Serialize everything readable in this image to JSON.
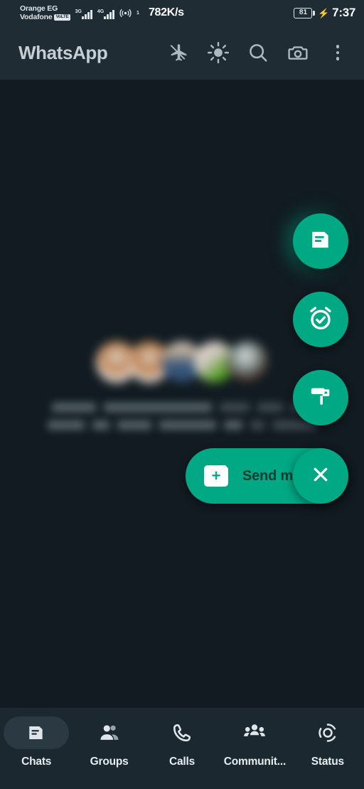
{
  "status_bar": {
    "carrier_primary": "Orange EG",
    "carrier_secondary": "Vodafone",
    "volte_badge": "VoLTE",
    "sim1_network": "3G",
    "sim2_network": "4G",
    "hotspot_superscript": "1",
    "network_speed": "782K/s",
    "battery_percent": "81",
    "charging_icon": "⚡",
    "time": "7:37"
  },
  "header": {
    "title": "WhatsApp",
    "actions": [
      {
        "name": "airplane-mode-icon",
        "label": "Airplane mode"
      },
      {
        "name": "brightness-icon",
        "label": "Brightness"
      },
      {
        "name": "search-icon",
        "label": "Search"
      },
      {
        "name": "camera-icon",
        "label": "Camera"
      },
      {
        "name": "overflow-menu-icon",
        "label": "More options"
      }
    ]
  },
  "main": {
    "invite_card": {
      "avatars_count": 5,
      "text_line1_redacted": true,
      "text_line2_redacted": true
    },
    "floating_actions": [
      {
        "name": "new-chat-fab",
        "icon": "message-icon",
        "highlighted": true
      },
      {
        "name": "reminder-fab",
        "icon": "alarm-check-icon",
        "highlighted": false
      },
      {
        "name": "theme-fab",
        "icon": "paint-roller-icon",
        "highlighted": false
      }
    ],
    "send_pill": {
      "label": "Send me",
      "icon": "note-plus-icon"
    },
    "close_button": {
      "label": "Close",
      "icon": "close-icon"
    }
  },
  "bottom_nav": {
    "items": [
      {
        "label": "Chats",
        "icon": "chats-icon",
        "active": true
      },
      {
        "label": "Groups",
        "icon": "groups-icon",
        "active": false
      },
      {
        "label": "Calls",
        "icon": "calls-icon",
        "active": false
      },
      {
        "label": "Communit...",
        "icon": "communities-icon",
        "active": false
      },
      {
        "label": "Status",
        "icon": "status-icon",
        "active": false
      }
    ]
  },
  "colors": {
    "background": "#111b21",
    "surface": "#1f2c34",
    "nav_background": "#1b282f",
    "accent_green": "#00a884",
    "active_pill": "#2a3942",
    "text_primary": "#e6edf1",
    "text_icon": "#aebac1"
  }
}
